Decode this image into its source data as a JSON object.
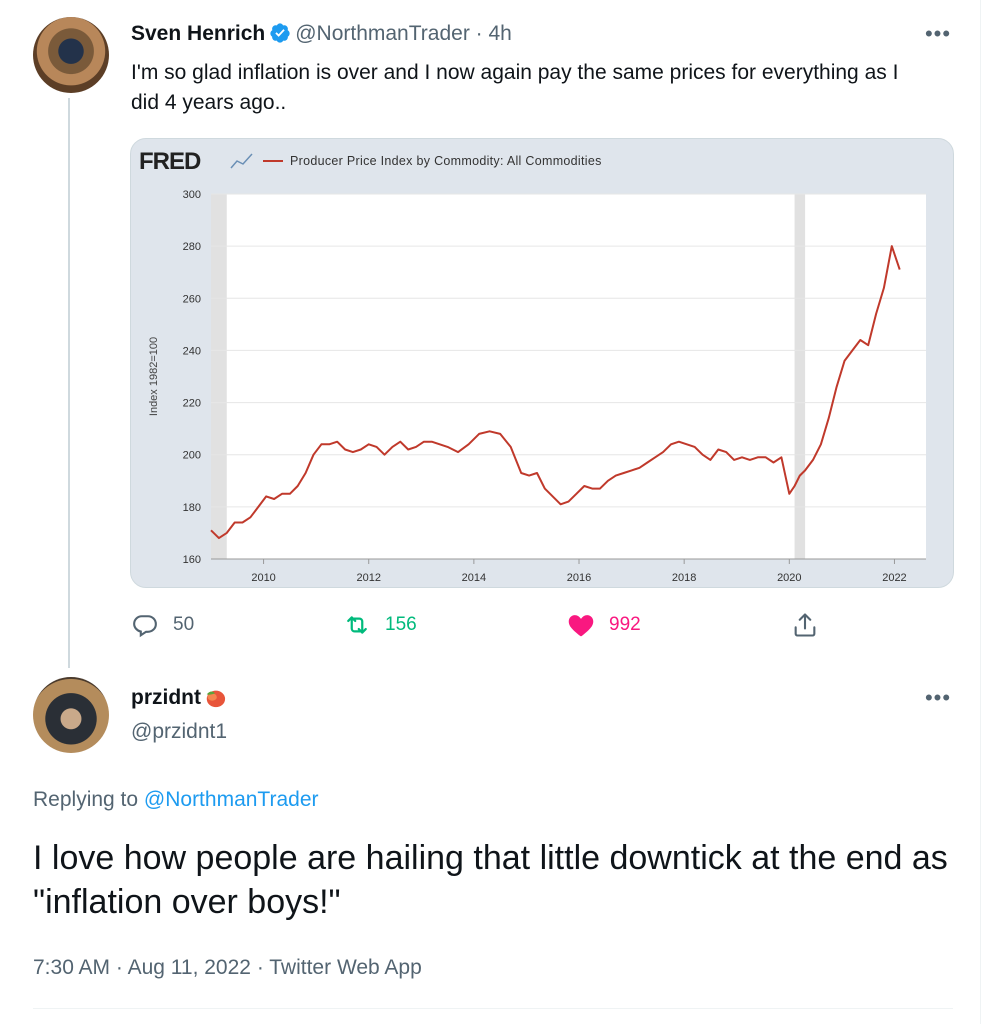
{
  "tweet1": {
    "name": "Sven Henrich",
    "handle": "@NorthmanTrader",
    "time": "4h",
    "text": "I'm so glad inflation is over and I now again pay the same prices for everything as I did 4 years ago..",
    "reply_count": "50",
    "retweet_count": "156",
    "like_count": "992"
  },
  "chart_data": {
    "type": "line",
    "brand": "FRED",
    "series": [
      {
        "name": "Producer Price Index by Commodity: All Commodities",
        "color": "#c0392b"
      }
    ],
    "ylabel": "Index 1982=100",
    "ylim": [
      160,
      300
    ],
    "yticks": [
      "160",
      "180",
      "200",
      "220",
      "240",
      "260",
      "280",
      "300"
    ],
    "xlim": [
      2009.0,
      2022.6
    ],
    "xticks": [
      "2010",
      "2012",
      "2014",
      "2016",
      "2018",
      "2020",
      "2022"
    ],
    "recessions": [
      [
        2009.0,
        2009.3
      ],
      [
        2020.1,
        2020.3
      ]
    ],
    "x": [
      2009.0,
      2009.15,
      2009.3,
      2009.45,
      2009.6,
      2009.75,
      2009.9,
      2010.05,
      2010.2,
      2010.35,
      2010.5,
      2010.65,
      2010.8,
      2010.95,
      2011.1,
      2011.25,
      2011.4,
      2011.55,
      2011.7,
      2011.85,
      2012.0,
      2012.15,
      2012.3,
      2012.45,
      2012.6,
      2012.75,
      2012.9,
      2013.05,
      2013.2,
      2013.35,
      2013.5,
      2013.7,
      2013.9,
      2014.1,
      2014.3,
      2014.5,
      2014.7,
      2014.9,
      2015.05,
      2015.2,
      2015.35,
      2015.5,
      2015.65,
      2015.8,
      2015.95,
      2016.1,
      2016.25,
      2016.4,
      2016.55,
      2016.7,
      2016.85,
      2017.0,
      2017.15,
      2017.3,
      2017.45,
      2017.6,
      2017.75,
      2017.9,
      2018.05,
      2018.2,
      2018.35,
      2018.5,
      2018.65,
      2018.8,
      2018.95,
      2019.1,
      2019.25,
      2019.4,
      2019.55,
      2019.7,
      2019.85,
      2020.0,
      2020.1,
      2020.2,
      2020.3,
      2020.45,
      2020.6,
      2020.75,
      2020.9,
      2021.05,
      2021.2,
      2021.35,
      2021.5,
      2021.65,
      2021.8,
      2021.95,
      2022.1,
      2022.25,
      2022.4,
      2022.5,
      2022.55
    ],
    "values": [
      171,
      168,
      170,
      174,
      174,
      176,
      180,
      184,
      183,
      185,
      185,
      188,
      193,
      200,
      204,
      204,
      205,
      202,
      201,
      202,
      204,
      203,
      200,
      203,
      205,
      202,
      203,
      205,
      205,
      204,
      203,
      201,
      204,
      208,
      209,
      208,
      203,
      193,
      192,
      193,
      187,
      184,
      181,
      182,
      185,
      188,
      187,
      187,
      190,
      192,
      193,
      194,
      195,
      197,
      199,
      201,
      204,
      205,
      204,
      203,
      200,
      198,
      202,
      201,
      198,
      199,
      198,
      199,
      199,
      197,
      199,
      185,
      188,
      192,
      194,
      198,
      204,
      214,
      226,
      236,
      240,
      244,
      242,
      254,
      264,
      280,
      271
    ]
  },
  "tweet2": {
    "name": "przidnt",
    "handle": "@przidnt1",
    "replying_prefix": "Replying to",
    "replying_to": "@NorthmanTrader",
    "text": "I love how people are hailing that little downtick at the end as \"inflation over boys!\"",
    "time": "7:30 AM",
    "date": "Aug 11, 2022",
    "source": "Twitter Web App"
  },
  "colors": {
    "accent": "#1d9bf0",
    "retweet": "#00ba7c",
    "like": "#f91880",
    "secondary_text": "#536471"
  }
}
